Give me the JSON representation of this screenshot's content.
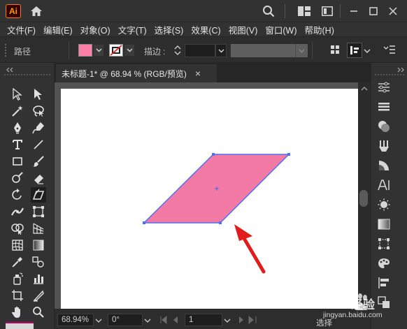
{
  "app": {
    "logo": "Ai",
    "accent": "#ff7b00"
  },
  "menu": [
    "文件(F)",
    "编辑(E)",
    "对象(O)",
    "文字(T)",
    "选择(S)",
    "效果(C)",
    "视图(V)",
    "窗口(W)",
    "帮助(H)"
  ],
  "control": {
    "object_type": "路径",
    "fill_color": "#ff7fa8",
    "stroke_label": "描边",
    "stroke_value": ""
  },
  "document": {
    "tab_title": "未标题-1* @ 68.94 % (RGB/预览)",
    "close_label": "×"
  },
  "shape": {
    "fill": "#f27aa5",
    "stroke": "#4f6ff2"
  },
  "status": {
    "zoom": "68.94%",
    "rotation": "0°",
    "artboard": "1",
    "mode": "选择"
  },
  "watermark": {
    "brand": "Baidu 经验",
    "url": "jingyan.baidu.com"
  },
  "icons": [
    "home-icon",
    "search-icon",
    "workspace-icon",
    "window-minimize-icon",
    "window-maximize-icon",
    "window-close-icon"
  ]
}
